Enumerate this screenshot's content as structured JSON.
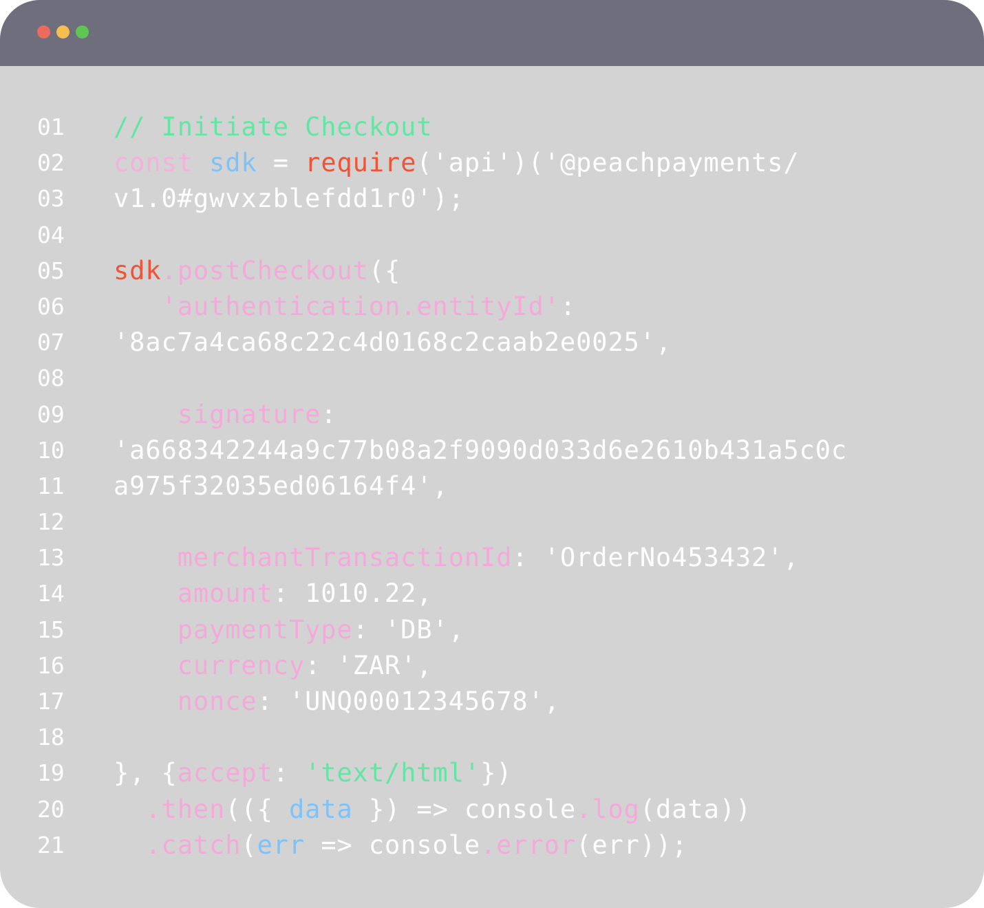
{
  "window": {
    "controls": [
      {
        "name": "close",
        "color": "#ec6a5e"
      },
      {
        "name": "minimize",
        "color": "#f4bf4f"
      },
      {
        "name": "maximize",
        "color": "#61c554"
      }
    ]
  },
  "colors": {
    "comment": "#65e5a3",
    "keyword": "#f5b0dc",
    "variable": "#7ec3f8",
    "function": "#f25335",
    "property": "#f5a9da",
    "string": "#65e5a3",
    "text": "#ffffff"
  },
  "code": {
    "lines": [
      {
        "number": "01",
        "tokens": [
          {
            "text": "// Initiate Checkout",
            "type": "comment"
          }
        ]
      },
      {
        "number": "02",
        "tokens": [
          {
            "text": "const",
            "type": "keyword"
          },
          {
            "text": " ",
            "type": "text"
          },
          {
            "text": "sdk",
            "type": "variable"
          },
          {
            "text": " = ",
            "type": "text"
          },
          {
            "text": "require",
            "type": "function"
          },
          {
            "text": "('api')('@peachpayments/",
            "type": "text"
          }
        ]
      },
      {
        "number": "03",
        "tokens": [
          {
            "text": "v1.0#gwvxzblefdd1r0');",
            "type": "text"
          }
        ]
      },
      {
        "number": "04",
        "tokens": []
      },
      {
        "number": "05",
        "tokens": [
          {
            "text": "sdk",
            "type": "function"
          },
          {
            "text": ".postCheckout",
            "type": "property"
          },
          {
            "text": "({",
            "type": "text"
          }
        ]
      },
      {
        "number": "06",
        "tokens": [
          {
            "text": "   ",
            "type": "text"
          },
          {
            "text": "'authentication.entityId'",
            "type": "property"
          },
          {
            "text": ":",
            "type": "text"
          }
        ]
      },
      {
        "number": "07",
        "tokens": [
          {
            "text": "'8ac7a4ca68c22c4d0168c2caab2e0025',",
            "type": "text"
          }
        ]
      },
      {
        "number": "08",
        "tokens": []
      },
      {
        "number": "09",
        "tokens": [
          {
            "text": "    ",
            "type": "text"
          },
          {
            "text": "signature",
            "type": "property"
          },
          {
            "text": ":",
            "type": "text"
          }
        ]
      },
      {
        "number": "10",
        "tokens": [
          {
            "text": "'a668342244a9c77b08a2f9090d033d6e2610b431a5c0c",
            "type": "text"
          }
        ]
      },
      {
        "number": "11",
        "tokens": [
          {
            "text": "a975f32035ed06164f4',",
            "type": "text"
          }
        ]
      },
      {
        "number": "12",
        "tokens": []
      },
      {
        "number": "13",
        "tokens": [
          {
            "text": "    ",
            "type": "text"
          },
          {
            "text": "merchantTransactionId",
            "type": "property"
          },
          {
            "text": ": 'OrderNo453432',",
            "type": "text"
          }
        ]
      },
      {
        "number": "14",
        "tokens": [
          {
            "text": "    ",
            "type": "text"
          },
          {
            "text": "amount",
            "type": "property"
          },
          {
            "text": ": 1010.22,",
            "type": "text"
          }
        ]
      },
      {
        "number": "15",
        "tokens": [
          {
            "text": "    ",
            "type": "text"
          },
          {
            "text": "paymentType",
            "type": "property"
          },
          {
            "text": ": 'DB',",
            "type": "text"
          }
        ]
      },
      {
        "number": "16",
        "tokens": [
          {
            "text": "    ",
            "type": "text"
          },
          {
            "text": "currency",
            "type": "property"
          },
          {
            "text": ": 'ZAR',",
            "type": "text"
          }
        ]
      },
      {
        "number": "17",
        "tokens": [
          {
            "text": "    ",
            "type": "text"
          },
          {
            "text": "nonce",
            "type": "property"
          },
          {
            "text": ": 'UNQ00012345678',",
            "type": "text"
          }
        ]
      },
      {
        "number": "18",
        "tokens": []
      },
      {
        "number": "19",
        "tokens": [
          {
            "text": "}, {",
            "type": "text"
          },
          {
            "text": "accept",
            "type": "property"
          },
          {
            "text": ": ",
            "type": "text"
          },
          {
            "text": "'text/html'",
            "type": "string"
          },
          {
            "text": "})",
            "type": "text"
          }
        ]
      },
      {
        "number": "20",
        "tokens": [
          {
            "text": "  ",
            "type": "text"
          },
          {
            "text": ".then",
            "type": "property"
          },
          {
            "text": "(({ ",
            "type": "text"
          },
          {
            "text": "data",
            "type": "variable"
          },
          {
            "text": " }) => console",
            "type": "text"
          },
          {
            "text": ".log",
            "type": "property"
          },
          {
            "text": "(data))",
            "type": "text"
          }
        ]
      },
      {
        "number": "21",
        "tokens": [
          {
            "text": "  ",
            "type": "text"
          },
          {
            "text": ".catch",
            "type": "property"
          },
          {
            "text": "(",
            "type": "text"
          },
          {
            "text": "err",
            "type": "variable"
          },
          {
            "text": " => console",
            "type": "text"
          },
          {
            "text": ".error",
            "type": "property"
          },
          {
            "text": "(err));",
            "type": "text"
          }
        ]
      }
    ]
  }
}
